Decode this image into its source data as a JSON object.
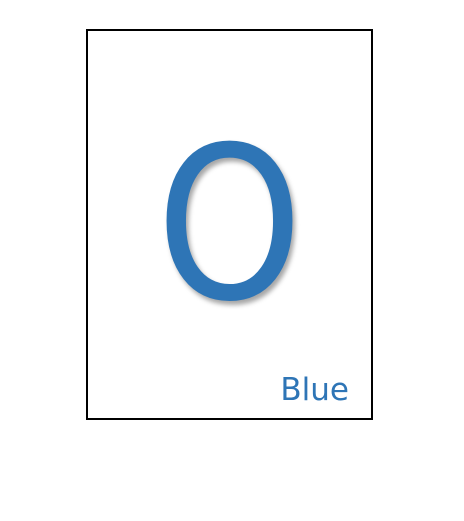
{
  "card": {
    "letter": "O",
    "label": "Blue",
    "color": "#2e75b6"
  }
}
